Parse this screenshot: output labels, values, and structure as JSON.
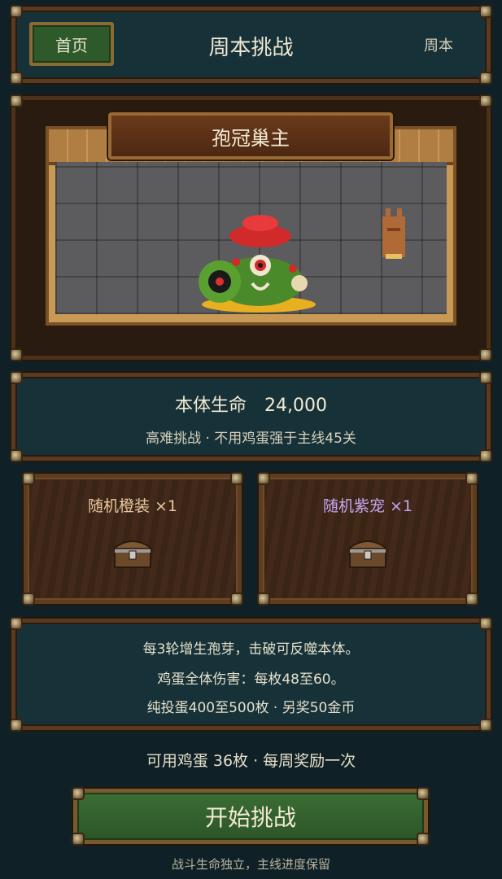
{
  "header": {
    "home_label": "首页",
    "title": "周本挑战",
    "week_label": "周本"
  },
  "boss": {
    "name": "孢冠巢主"
  },
  "stats": {
    "hp_label": "本体生命",
    "hp_value": "24,000",
    "subtitle": "高难挑战 · 不用鸡蛋强于主线45关"
  },
  "rewards": [
    {
      "label": "随机橙装 ×1",
      "color": "#e9c9a0"
    },
    {
      "label": "随机紫宠 ×1",
      "color": "#c7a6f0"
    }
  ],
  "info": {
    "lines": [
      "每3轮增生孢芽，击破可反噬本体。",
      "鸡蛋全体伤害：每枚48至60。",
      "纯投蛋400至500枚 · 另奖50金币"
    ]
  },
  "footer": {
    "eggs_line": "可用鸡蛋 36枚 · 每周奖励一次"
  },
  "start_button": {
    "label": "开始挑战"
  },
  "note": "战斗生命独立，主线进度保留",
  "colors": {
    "panel": "#163238",
    "frame": "#5a3a20",
    "button_green": "#2e5a2b"
  }
}
